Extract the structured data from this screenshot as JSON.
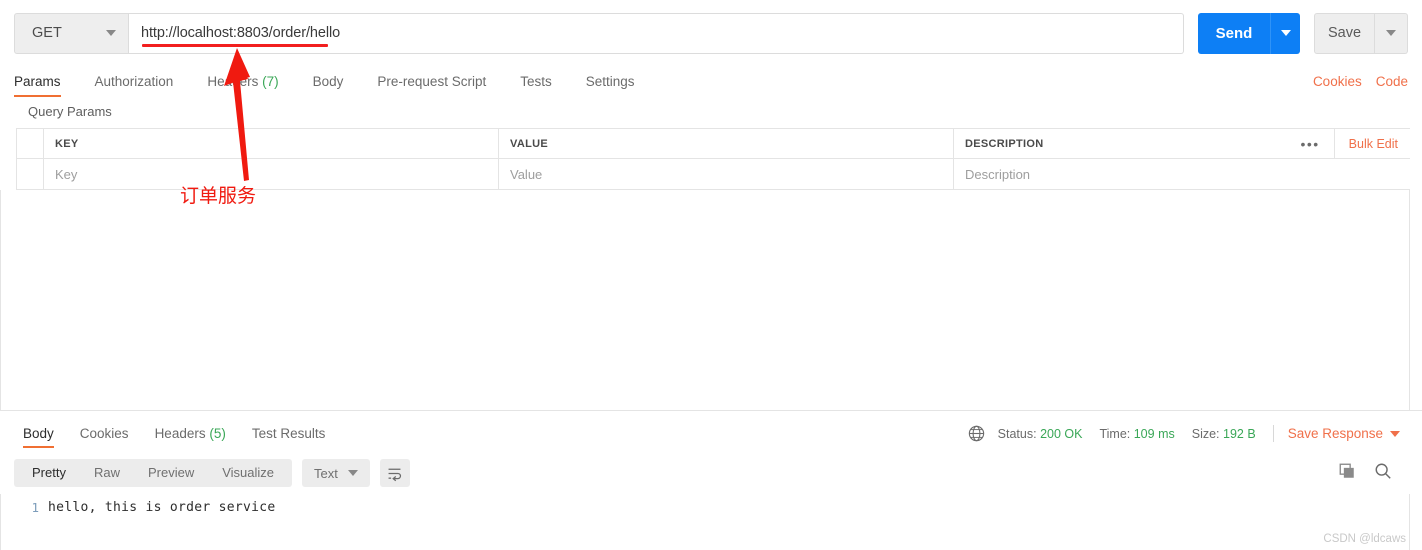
{
  "request": {
    "method": "GET",
    "url": "http://localhost:8803/order/hello",
    "send_label": "Send",
    "save_label": "Save",
    "tabs": [
      {
        "label": "Params",
        "active": true,
        "count": ""
      },
      {
        "label": "Authorization",
        "active": false,
        "count": ""
      },
      {
        "label": "Headers",
        "active": false,
        "count": "(7)"
      },
      {
        "label": "Body",
        "active": false,
        "count": ""
      },
      {
        "label": "Pre-request Script",
        "active": false,
        "count": ""
      },
      {
        "label": "Tests",
        "active": false,
        "count": ""
      },
      {
        "label": "Settings",
        "active": false,
        "count": ""
      }
    ],
    "cookies_link": "Cookies",
    "code_link": "Code"
  },
  "params": {
    "section_label": "Query Params",
    "headers": {
      "key": "KEY",
      "value": "VALUE",
      "description": "DESCRIPTION"
    },
    "placeholders": {
      "key": "Key",
      "value": "Value",
      "description": "Description"
    },
    "more_dots": "•••",
    "bulk_edit": "Bulk Edit"
  },
  "annotation": {
    "text": "订单服务",
    "color": "#f01a10"
  },
  "response": {
    "tabs": [
      {
        "label": "Body",
        "active": true,
        "count": ""
      },
      {
        "label": "Cookies",
        "active": false,
        "count": ""
      },
      {
        "label": "Headers",
        "active": false,
        "count": "(5)"
      },
      {
        "label": "Test Results",
        "active": false,
        "count": ""
      }
    ],
    "status_label": "Status:",
    "status_value": "200 OK",
    "time_label": "Time:",
    "time_value": "109 ms",
    "size_label": "Size:",
    "size_value": "192 B",
    "save_response": "Save Response",
    "view_modes": [
      {
        "label": "Pretty",
        "active": true
      },
      {
        "label": "Raw",
        "active": false
      },
      {
        "label": "Preview",
        "active": false
      },
      {
        "label": "Visualize",
        "active": false
      }
    ],
    "format": "Text",
    "body_lines": [
      {
        "no": "1",
        "text": "hello, this is order service"
      }
    ]
  },
  "watermark": "CSDN @ldcaws",
  "colors": {
    "accent_orange": "#f06f32",
    "send_blue": "#0d7ff5",
    "green": "#3aa757",
    "annotation_red": "#f01a10"
  }
}
